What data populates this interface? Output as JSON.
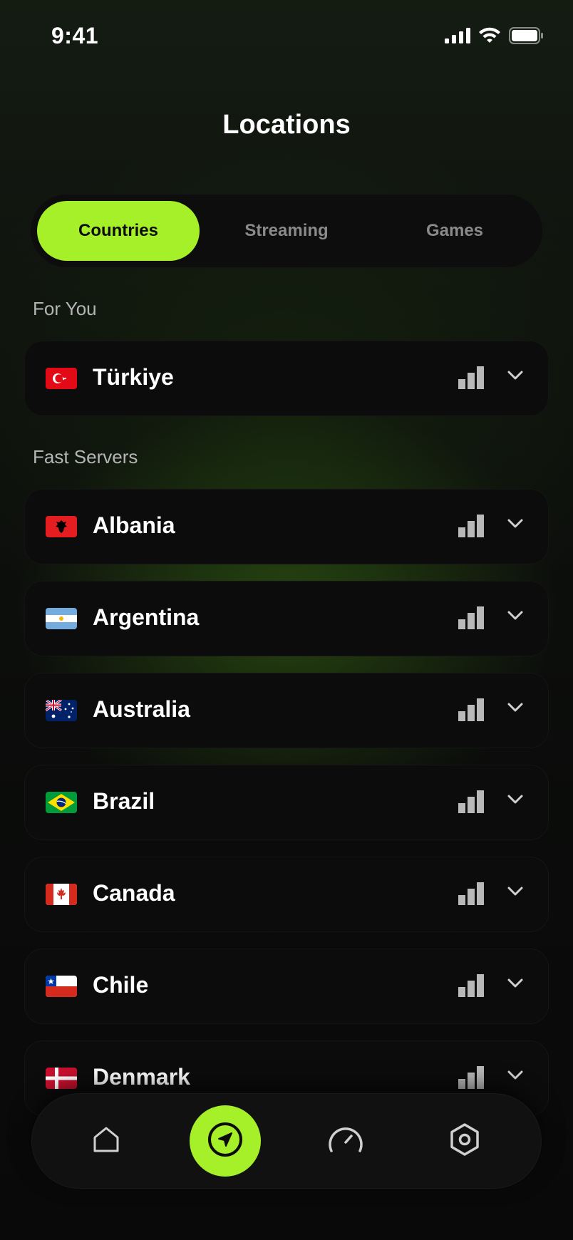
{
  "status_bar": {
    "time": "9:41"
  },
  "header": {
    "title": "Locations"
  },
  "tabs": [
    {
      "label": "Countries",
      "active": true
    },
    {
      "label": "Streaming",
      "active": false
    },
    {
      "label": "Games",
      "active": false
    }
  ],
  "sections": {
    "for_you": {
      "label": "For You",
      "items": [
        {
          "name": "Türkiye",
          "flag": "turkey-flag-icon"
        }
      ]
    },
    "fast_servers": {
      "label": "Fast Servers",
      "items": [
        {
          "name": "Albania",
          "flag": "albania-flag-icon"
        },
        {
          "name": "Argentina",
          "flag": "argentina-flag-icon"
        },
        {
          "name": "Australia",
          "flag": "australia-flag-icon"
        },
        {
          "name": "Brazil",
          "flag": "brazil-flag-icon"
        },
        {
          "name": "Canada",
          "flag": "canada-flag-icon"
        },
        {
          "name": "Chile",
          "flag": "chile-flag-icon"
        },
        {
          "name": "Denmark",
          "flag": "denmark-flag-icon"
        }
      ]
    }
  },
  "bottom_nav": [
    {
      "icon": "home-icon",
      "active": false
    },
    {
      "icon": "locations-navigation-icon",
      "active": true
    },
    {
      "icon": "speedometer-icon",
      "active": false
    },
    {
      "icon": "settings-hexagon-icon",
      "active": false
    }
  ],
  "colors": {
    "accent": "#a6f02a",
    "background": "#0a0b0a",
    "card": "#0c0c0c",
    "muted_text": "#8a8a8a"
  }
}
